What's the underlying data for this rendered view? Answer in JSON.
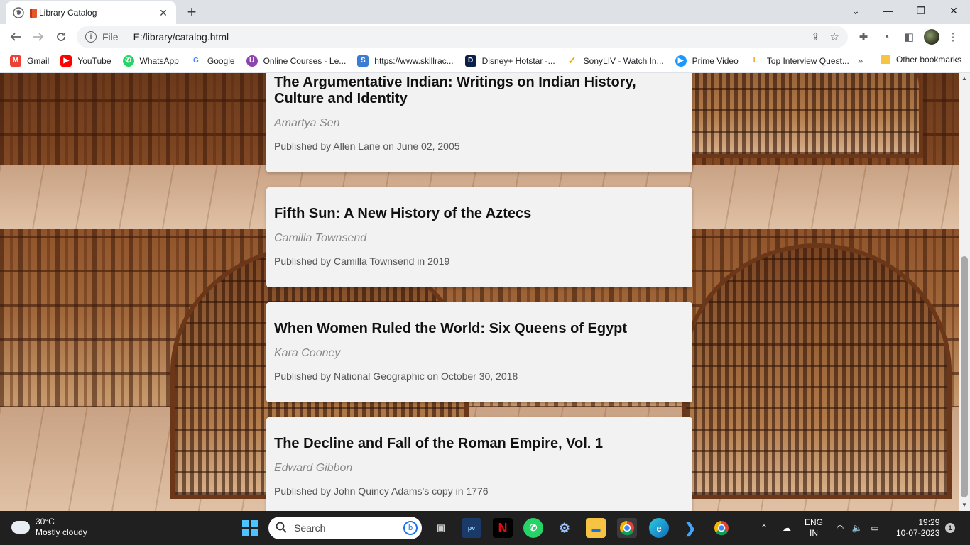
{
  "browser": {
    "tab_title": "Library Catalog",
    "new_tab_label": "+",
    "protocol_label": "File",
    "url": "E:/library/catalog.html"
  },
  "bookmarks": [
    {
      "label": "Gmail",
      "icon": "gmail-icon",
      "color": "#ea4335",
      "glyph": "M"
    },
    {
      "label": "YouTube",
      "icon": "youtube-icon",
      "color": "#ff0000",
      "glyph": "▶"
    },
    {
      "label": "WhatsApp",
      "icon": "whatsapp-icon",
      "color": "#25d366",
      "glyph": "✆"
    },
    {
      "label": "Google",
      "icon": "google-icon",
      "color": "#4285f4",
      "glyph": "G"
    },
    {
      "label": "Online Courses - Le...",
      "icon": "courses-icon",
      "color": "#8e44ad",
      "glyph": "U"
    },
    {
      "label": "https://www.skillrac...",
      "icon": "skillrack-icon",
      "color": "#3a7bd5",
      "glyph": "S"
    },
    {
      "label": "Disney+ Hotstar -...",
      "icon": "hotstar-icon",
      "color": "#0c1e4a",
      "glyph": "D"
    },
    {
      "label": "SonyLIV - Watch In...",
      "icon": "sonyliv-icon",
      "color": "#e0b000",
      "glyph": "✓"
    },
    {
      "label": "Prime Video",
      "icon": "primevideo-icon",
      "color": "#1a98ff",
      "glyph": "▶"
    },
    {
      "label": "Top Interview Quest...",
      "icon": "leetcode-icon",
      "color": "#f89f1b",
      "glyph": "L"
    }
  ],
  "bookmarks_more": "»",
  "other_bookmarks": "Other bookmarks",
  "books": [
    {
      "title": "The Argumentative Indian: Writings on Indian History, Culture and Identity",
      "author": "Amartya Sen",
      "published": "Published by Allen Lane on June 02, 2005"
    },
    {
      "title": "Fifth Sun: A New History of the Aztecs",
      "author": "Camilla Townsend",
      "published": "Published by Camilla Townsend in 2019"
    },
    {
      "title": "When Women Ruled the World: Six Queens of Egypt",
      "author": "Kara Cooney",
      "published": "Published by National Geographic on October 30, 2018"
    },
    {
      "title": "The Decline and Fall of the Roman Empire, Vol. 1",
      "author": "Edward Gibbon",
      "published": "Published by John Quincy Adams's copy in 1776"
    }
  ],
  "taskbar": {
    "temperature": "30°C",
    "weather": "Mostly cloudy",
    "search_placeholder": "Search",
    "lang_1": "ENG",
    "lang_2": "IN",
    "time": "19:29",
    "date": "10-07-2023",
    "notifications": "1"
  }
}
